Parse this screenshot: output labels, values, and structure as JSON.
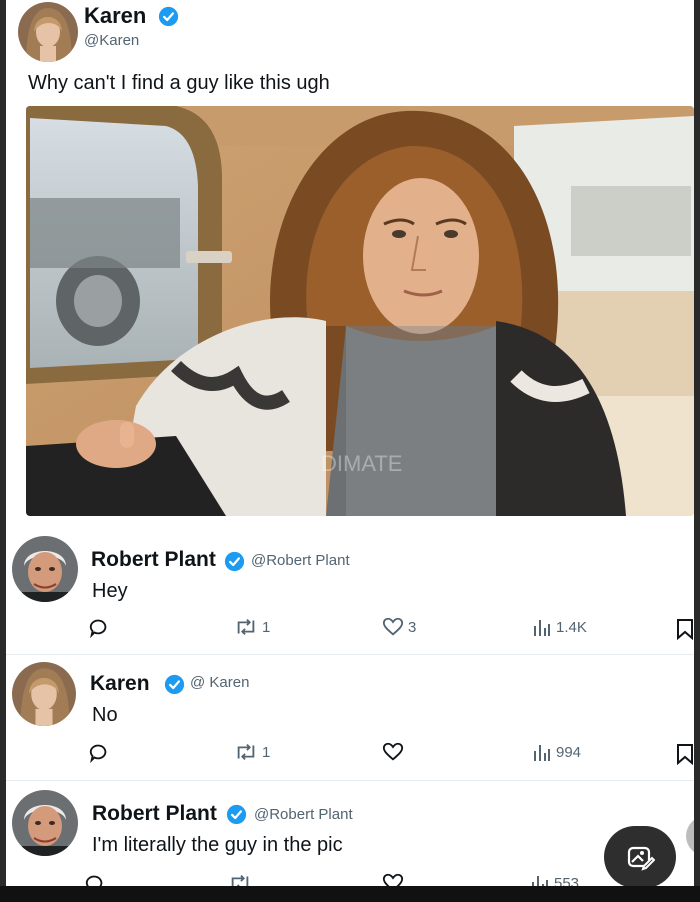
{
  "post": {
    "author_name": "Karen",
    "author_handle": "@Karen",
    "text": "Why can't I find a guy like this ugh",
    "watermark": "DIMATE"
  },
  "replies": [
    {
      "author_name": "Robert Plant",
      "author_handle": "@Robert Plant",
      "text": "Hey",
      "replies_count": "",
      "retweets_count": "1",
      "likes_count": "3",
      "views_count": "1.4K"
    },
    {
      "author_name": "Karen",
      "author_handle": "@ Karen",
      "text": "No",
      "replies_count": "",
      "retweets_count": "1",
      "likes_count": "",
      "views_count": "994"
    },
    {
      "author_name": "Robert Plant",
      "author_handle": "@Robert Plant",
      "text": "I'm literally the guy in the pic",
      "views_count": "553"
    }
  ],
  "colors": {
    "verified": "#1d9bf0",
    "text": "#0f1419",
    "muted": "#536471"
  },
  "icons": [
    "verified-icon",
    "reply-icon",
    "retweet-icon",
    "like-icon",
    "views-icon",
    "bookmark-icon",
    "image-edit-icon"
  ]
}
